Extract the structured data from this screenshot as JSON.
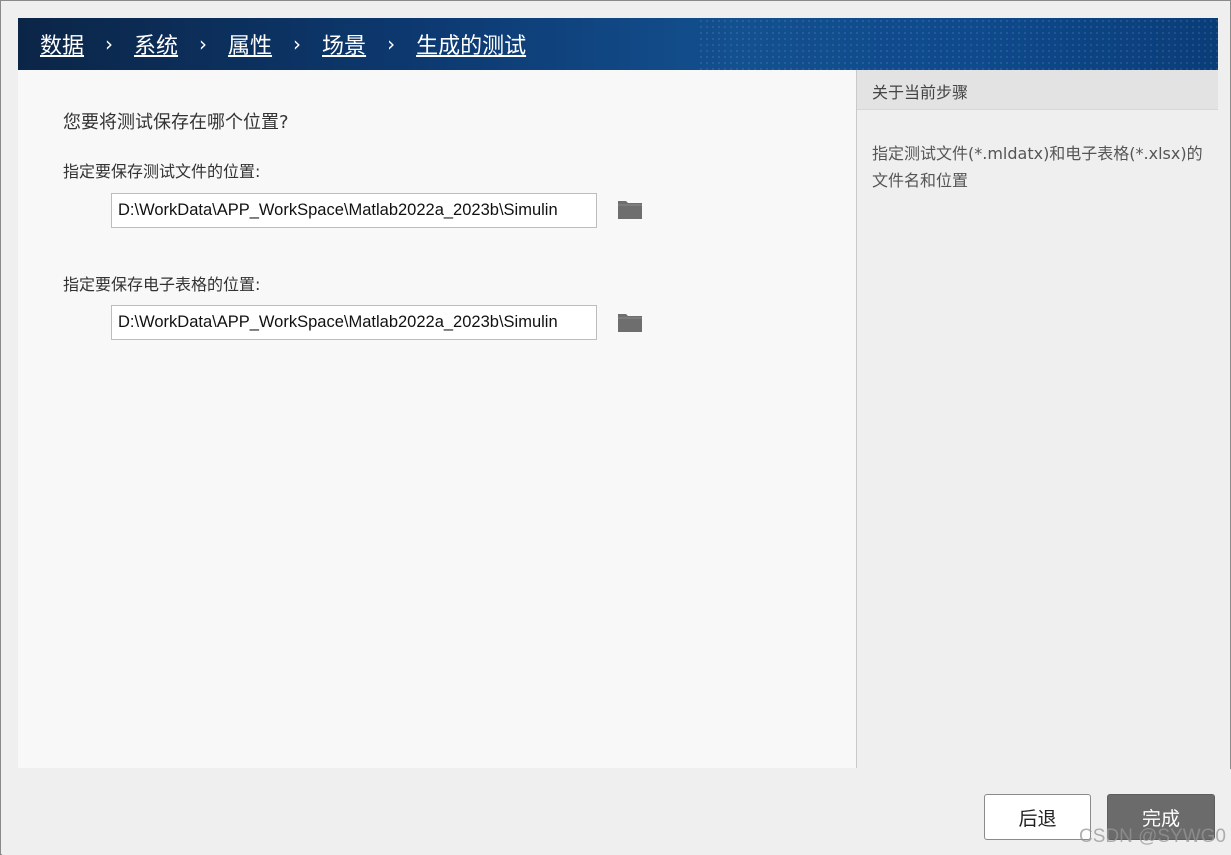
{
  "breadcrumb": {
    "items": [
      {
        "label": "数据"
      },
      {
        "label": "系统"
      },
      {
        "label": "属性"
      },
      {
        "label": "场景"
      },
      {
        "label": "生成的测试"
      }
    ],
    "separator": "›"
  },
  "main": {
    "question": "您要将测试保存在哪个位置?",
    "test_file": {
      "label": "指定要保存测试文件的位置:",
      "value": "D:\\WorkData\\APP_WorkSpace\\Matlab2022a_2023b\\Simulin"
    },
    "spreadsheet": {
      "label": "指定要保存电子表格的位置:",
      "value": "D:\\WorkData\\APP_WorkSpace\\Matlab2022a_2023b\\Simulin"
    }
  },
  "info": {
    "title": "关于当前步骤",
    "body": "指定测试文件(*.mldatx)和电子表格(*.xlsx)的文件名和位置"
  },
  "buttons": {
    "back": "后退",
    "finish": "完成"
  },
  "watermark": "CSDN @SYWG0",
  "icons": {
    "browse": "folder-icon"
  },
  "colors": {
    "banner": "#0d3a72",
    "finish_button": "#6b6b6b",
    "folder_icon": "#6e6e6e"
  }
}
